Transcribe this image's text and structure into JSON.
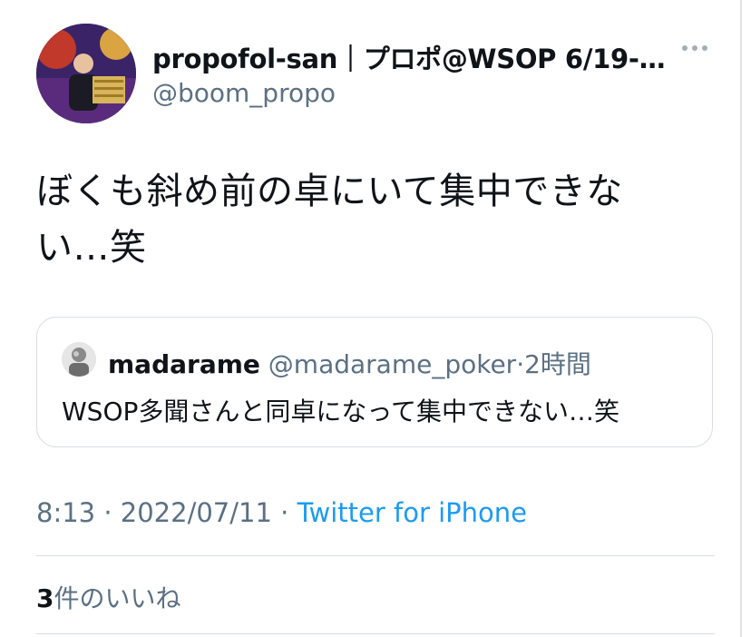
{
  "tweet": {
    "author": {
      "display_name": "propofol-san｜プロポ@WSOP 6/19-…",
      "handle": "@boom_propo"
    },
    "text_line1": "ぼくも斜め前の卓にいて集中できな",
    "text_line2": "い…笑",
    "quoted": {
      "name": "madarame",
      "handle": "@madarame_poker",
      "separator": "·",
      "time": "2時間",
      "text": "WSOP多聞さんと同卓になって集中できない…笑"
    },
    "time": "8:13",
    "sep1": "·",
    "date": "2022/07/11",
    "sep2": "·",
    "source": "Twitter for iPhone",
    "likes_count": "3",
    "likes_label": "件のいいね"
  },
  "colors": {
    "text": "#0f1419",
    "secondary": "#5b7083",
    "link": "#1d9bf0",
    "border": "#d8dde1"
  },
  "icons": {
    "more": "more-horizontal-icon"
  }
}
